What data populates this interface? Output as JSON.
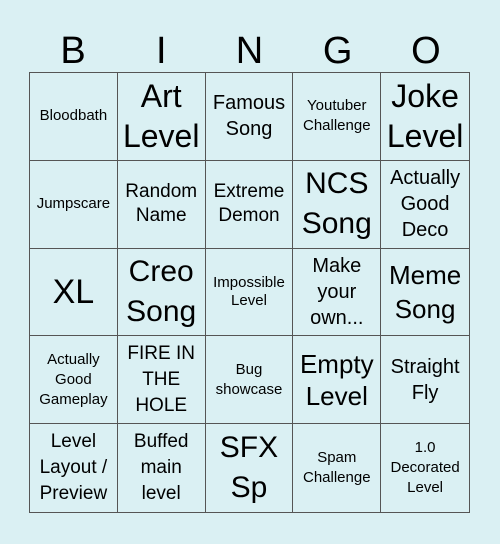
{
  "card": {
    "header": [
      "B",
      "I",
      "N",
      "G",
      "O"
    ],
    "rows": [
      [
        "Bloodbath",
        "Art Level",
        "Famous Song",
        "Youtuber Challenge",
        "Joke Level"
      ],
      [
        "Jumpscare",
        "Random Name",
        "Extreme Demon",
        "NCS Song",
        "Actually Good Deco"
      ],
      [
        "XL",
        "Creo Song",
        "Impossible Level",
        "Make your own...",
        "Meme Song"
      ],
      [
        "Actually Good Gameplay",
        "FIRE IN THE HOLE",
        "Bug showcase",
        "Empty Level",
        "Straight Fly"
      ],
      [
        "Level Layout / Preview",
        "Buffed main level",
        "SFX Sp",
        "Spam Challenge",
        "1.0 Decorated Level"
      ]
    ]
  },
  "colors": {
    "background": "#daf0f3",
    "grid_line": "#555555",
    "text": "#000000"
  }
}
